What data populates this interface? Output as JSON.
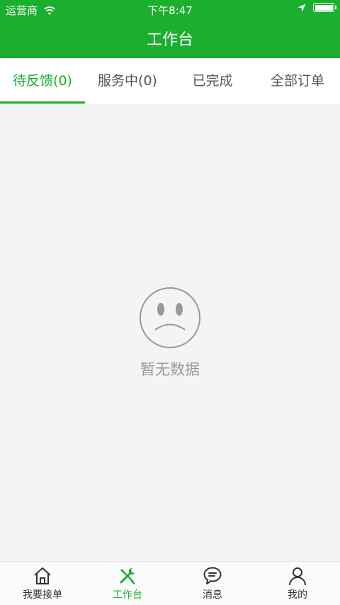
{
  "status_bar": {
    "carrier": "运营商",
    "time": "下午8:47"
  },
  "nav": {
    "title": "工作台"
  },
  "tabs": [
    {
      "label": "待反馈(0)",
      "active": true
    },
    {
      "label": "服务中(0)",
      "active": false
    },
    {
      "label": "已完成",
      "active": false
    },
    {
      "label": "全部订单",
      "active": false
    }
  ],
  "empty_state": {
    "text": "暂无数据"
  },
  "tabbar": [
    {
      "label": "我要接单",
      "icon": "home-icon"
    },
    {
      "label": "工作台",
      "icon": "tools-icon",
      "active": true
    },
    {
      "label": "消息",
      "icon": "chat-bubble-icon"
    },
    {
      "label": "我的",
      "icon": "user-icon"
    }
  ],
  "colors": {
    "accent": "#1aaf2e",
    "background": "#f4f4f4",
    "muted_text": "#999999"
  }
}
